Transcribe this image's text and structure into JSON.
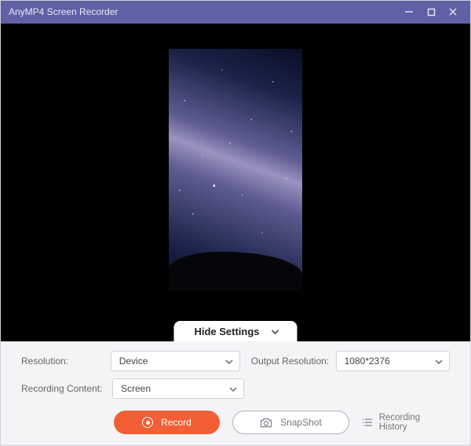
{
  "titlebar": {
    "title": "AnyMP4 Screen Recorder"
  },
  "preview": {
    "hide_settings_label": "Hide Settings"
  },
  "settings": {
    "resolution_label": "Resolution:",
    "resolution_value": "Device",
    "output_resolution_label": "Output Resolution:",
    "output_resolution_value": "1080*2376",
    "recording_content_label": "Recording Content:",
    "recording_content_value": "Screen"
  },
  "actions": {
    "record_label": "Record",
    "snapshot_label": "SnapShot",
    "history_label": "Recording History"
  }
}
